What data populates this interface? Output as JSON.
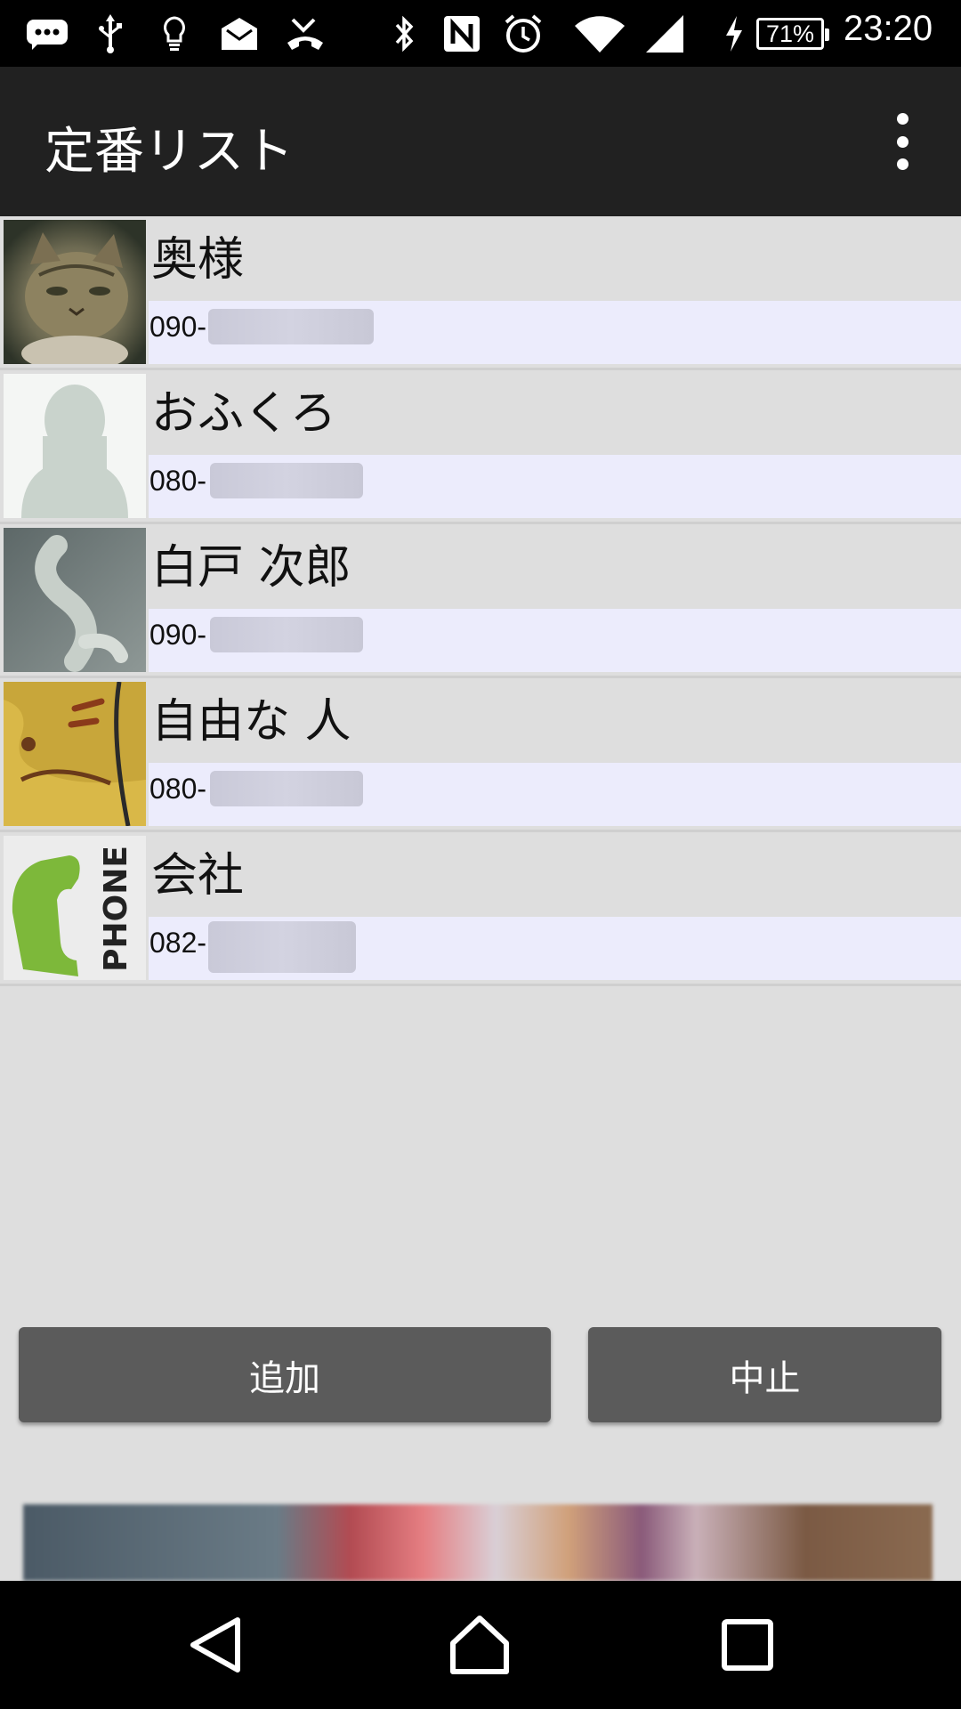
{
  "status_bar": {
    "time": "23:20",
    "battery": "71%",
    "icons": [
      "messenger-icon",
      "usb-icon",
      "lightbulb-icon",
      "mail-icon",
      "missed-call-icon",
      "bluetooth-icon",
      "nfc-icon",
      "alarm-icon",
      "wifi-icon",
      "signal-icon",
      "charging-icon"
    ]
  },
  "app_bar": {
    "title": "定番リスト",
    "overflow_icon": "more-vert-icon"
  },
  "contacts": [
    {
      "name": "奥様",
      "phone_prefix": "090-",
      "avatar": "cat-photo"
    },
    {
      "name": "おふくろ",
      "phone_prefix": "080-",
      "avatar": "silhouette"
    },
    {
      "name": "白戸 次郎",
      "phone_prefix": "090-",
      "avatar": "dog-tail-photo"
    },
    {
      "name": "自由な 人",
      "phone_prefix": "080-",
      "avatar": "yellow-cat-drawing"
    },
    {
      "name": "会社",
      "phone_prefix": "082-",
      "avatar": "phone-logo",
      "avatar_text": "PHONE"
    }
  ],
  "buttons": {
    "add": "追加",
    "cancel": "中止"
  },
  "nav_bar": {
    "icons": [
      "back-icon",
      "home-icon",
      "recents-icon"
    ]
  },
  "colors": {
    "app_bar": "#212121",
    "list_bg": "#dedede",
    "phone_row_bg": "#ececfc",
    "button_bg": "#5b5b5b"
  }
}
